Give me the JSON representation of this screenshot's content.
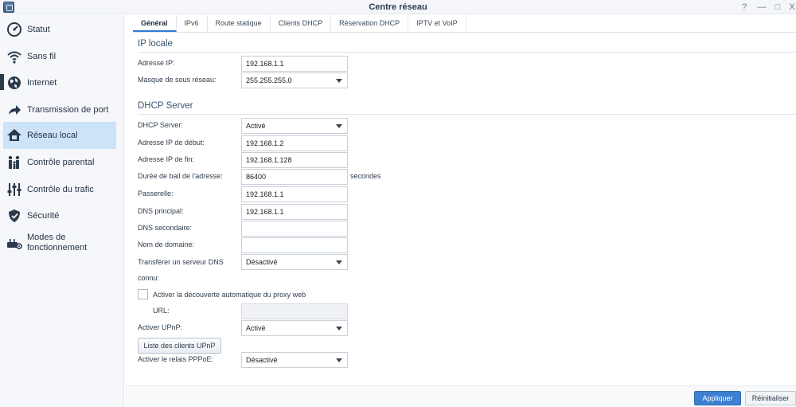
{
  "window": {
    "title": "Centre réseau",
    "buttons": {
      "help": "?",
      "minimize": "—",
      "maximize": "□",
      "close": "X"
    }
  },
  "sidebar": {
    "items": [
      {
        "label": "Statut",
        "icon": "gauge-icon"
      },
      {
        "label": "Sans fil",
        "icon": "wifi-icon"
      },
      {
        "label": "Internet",
        "icon": "globe-icon"
      },
      {
        "label": "Transmission de port",
        "icon": "forward-arrow-icon"
      },
      {
        "label": "Réseau local",
        "icon": "home-network-icon",
        "active": true
      },
      {
        "label": "Contrôle parental",
        "icon": "family-icon"
      },
      {
        "label": "Contrôle du trafic",
        "icon": "sliders-icon"
      },
      {
        "label": "Sécurité",
        "icon": "shield-icon"
      },
      {
        "label": "Modes de fonctionnement",
        "label_line1": "Modes de",
        "label_line2": "fonctionnement",
        "icon": "router-mode-icon"
      }
    ]
  },
  "tabs": [
    {
      "label": "Général",
      "active": true
    },
    {
      "label": "IPv6"
    },
    {
      "label": "Route statique"
    },
    {
      "label": "Clients DHCP"
    },
    {
      "label": "Réservation DHCP"
    },
    {
      "label": "IPTV et VoIP"
    }
  ],
  "ip_locale": {
    "title": "IP locale",
    "ip_label": "Adresse IP:",
    "ip_value": "192.168.1.1",
    "mask_label": "Masque de sous réseau:",
    "mask_value": "255.255.255.0"
  },
  "dhcp": {
    "title": "DHCP Server",
    "server_label": "DHCP Server:",
    "server_value": "Activé",
    "start_label": "Adresse IP de début:",
    "start_value": "192.168.1.2",
    "end_label": "Adresse IP de fin:",
    "end_value": "192.168.1.128",
    "lease_label": "Durée de bail de l'adresse:",
    "lease_value": "86400",
    "lease_unit": "secondes",
    "gateway_label": "Passerelle:",
    "gateway_value": "192.168.1.1",
    "dns1_label": "DNS principal:",
    "dns1_value": "192.168.1.1",
    "dns2_label": "DNS secondaire:",
    "dns2_value": "",
    "domain_label": "Nom de domaine:",
    "domain_value": "",
    "forward_label_line1": "Transférer un serveur DNS",
    "forward_label_line2": "connu:",
    "forward_value": "Désactivé",
    "proxy_label": "Activer la découverte automatique du proxy web",
    "proxy_checked": false,
    "url_label": "URL:",
    "url_value": "",
    "upnp_label": "Activer UPnP:",
    "upnp_value": "Activé",
    "upnp_button": "Liste des clients UPnP",
    "pppoe_label": "Activer le relais PPPoE:",
    "pppoe_value": "Désactivé"
  },
  "footer": {
    "apply": "Appliquer",
    "reset": "Réinitialiser"
  }
}
